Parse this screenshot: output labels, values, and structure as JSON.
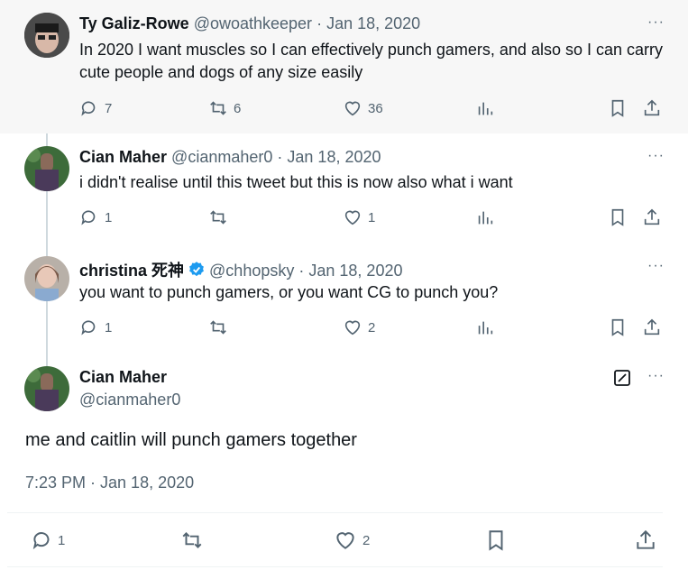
{
  "tweets": [
    {
      "name": "Ty Galiz-Rowe",
      "handle": "@owoathkeeper",
      "date": "Jan 18, 2020",
      "text": "In 2020 I want muscles so I can effectively punch gamers, and also so I can carry cute people and dogs of any size easily",
      "replies": "7",
      "retweets": "6",
      "likes": "36"
    },
    {
      "name": "Cian Maher",
      "handle": "@cianmaher0",
      "date": "Jan 18, 2020",
      "text": "i didn't realise until this tweet but this is now also what i want",
      "replies": "1",
      "retweets": "",
      "likes": "1"
    },
    {
      "name": "christina 死神",
      "handle": "@chhopsky",
      "date": "Jan 18, 2020",
      "text": "you want to punch gamers, or you want CG to punch you?",
      "replies": "1",
      "retweets": "",
      "likes": "2"
    }
  ],
  "main": {
    "name": "Cian Maher",
    "handle": "@cianmaher0",
    "text": "me and caitlin will punch gamers together",
    "timestamp": "7:23 PM · Jan 18, 2020",
    "replies": "1",
    "retweets": "",
    "likes": "2"
  },
  "separator": "·",
  "more": "···",
  "colors": {
    "verified": "#1d9bf0",
    "meta": "#536471",
    "thread_line": "#cfd9de"
  }
}
